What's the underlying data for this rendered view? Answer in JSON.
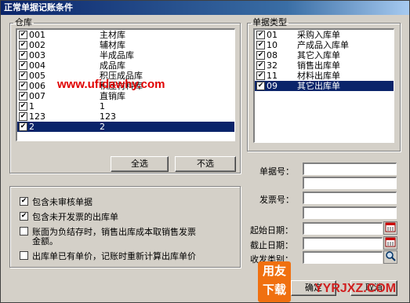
{
  "window": {
    "title": "正常单据记账条件"
  },
  "warehouse": {
    "legend": "仓库",
    "items": [
      {
        "code": "001",
        "name": "主材库",
        "checked": true,
        "selected": false
      },
      {
        "code": "002",
        "name": "辅材库",
        "checked": true,
        "selected": false
      },
      {
        "code": "003",
        "name": "半成品库",
        "checked": true,
        "selected": false
      },
      {
        "code": "004",
        "name": "成品库",
        "checked": true,
        "selected": false
      },
      {
        "code": "005",
        "name": "积压成品库",
        "checked": true,
        "selected": false
      },
      {
        "code": "006",
        "name": "积压材料库",
        "checked": true,
        "selected": false
      },
      {
        "code": "007",
        "name": "直销库",
        "checked": true,
        "selected": false
      },
      {
        "code": "1",
        "name": "1",
        "checked": true,
        "selected": false
      },
      {
        "code": "123",
        "name": "123",
        "checked": true,
        "selected": false
      },
      {
        "code": "2",
        "name": "2",
        "checked": true,
        "selected": true
      }
    ],
    "select_all_label": "全选",
    "deselect_label": "不选"
  },
  "doc_type": {
    "legend": "单据类型",
    "items": [
      {
        "code": "01",
        "name": "采购入库单",
        "checked": true,
        "selected": false
      },
      {
        "code": "10",
        "name": "产成品入库单",
        "checked": true,
        "selected": false
      },
      {
        "code": "08",
        "name": "其它入库单",
        "checked": true,
        "selected": false
      },
      {
        "code": "32",
        "name": "销售出库单",
        "checked": true,
        "selected": false
      },
      {
        "code": "11",
        "name": "材料出库单",
        "checked": true,
        "selected": false
      },
      {
        "code": "09",
        "name": "其它出库单",
        "checked": true,
        "selected": true
      }
    ]
  },
  "options": [
    {
      "label": "包含未审核单据",
      "checked": true
    },
    {
      "label": "包含未开发票的出库单",
      "checked": true
    },
    {
      "label": "账面为负结存时，销售出库成本取销售发票金额。",
      "line1": "账面为负结存时，销售出库成本取销售发票",
      "line2": "金额。",
      "checked": false
    },
    {
      "label": "出库单已有单价，记账时重新计算出库单价",
      "checked": false
    }
  ],
  "fields": {
    "doc_no_label": "单据号：",
    "doc_no_from": "",
    "doc_no_to": "",
    "invoice_no_label": "发票号：",
    "invoice_no_from": "",
    "invoice_no_to": "",
    "start_date_label": "起始日期：",
    "start_date": "",
    "end_date_label": "截止日期：",
    "end_date": "",
    "send_type_label": "收发类别：",
    "send_type": ""
  },
  "buttons": {
    "ok": "确定",
    "cancel": "取消"
  },
  "watermark": {
    "site": "www.ufidawhy.com",
    "logo_line1": "用友",
    "logo_line2": "下载",
    "brand": "YYRJXZ.COM"
  },
  "icons": {
    "calendar": "calendar-icon",
    "search": "search-icon"
  }
}
